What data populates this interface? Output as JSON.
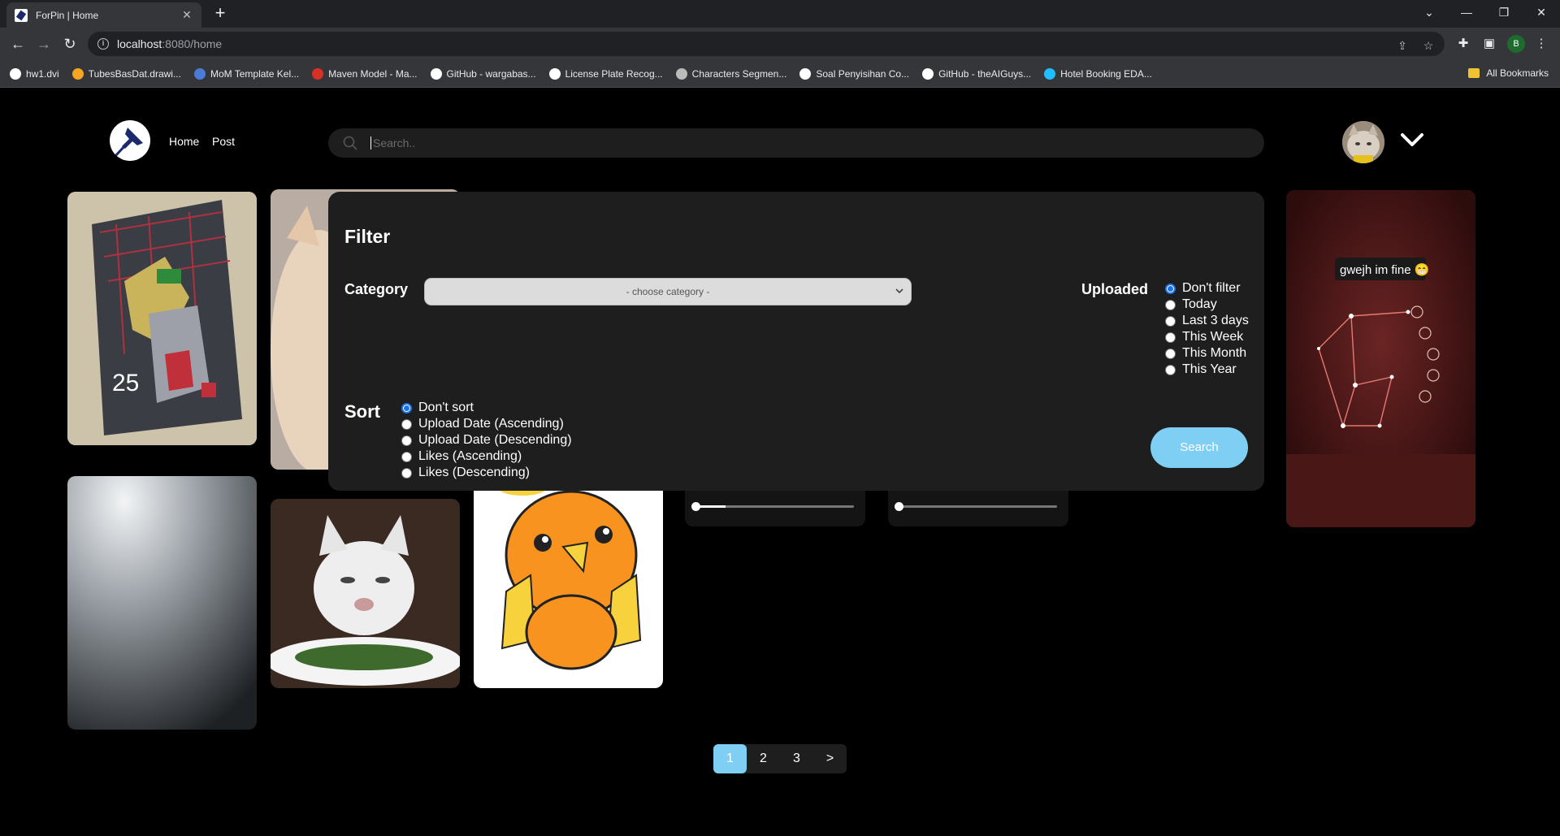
{
  "browser": {
    "tab_title": "ForPin | Home",
    "url_host": "localhost",
    "url_path": ":8080/home",
    "profile_initial": "B",
    "bookmarks": [
      {
        "label": "hw1.dvi",
        "color": "#ffffff"
      },
      {
        "label": "TubesBasDat.drawi...",
        "color": "#f5a623"
      },
      {
        "label": "MoM Template Kel...",
        "color": "#4a7bd8"
      },
      {
        "label": "Maven Model - Ma...",
        "color": "#d93025"
      },
      {
        "label": "GitHub - wargabas...",
        "color": "#ffffff"
      },
      {
        "label": "License Plate Recog...",
        "color": "#ffffff"
      },
      {
        "label": "Characters Segmen...",
        "color": "#bbbbbb"
      },
      {
        "label": "Soal Penyisihan Co...",
        "color": "#ffffff"
      },
      {
        "label": "GitHub - theAIGuys...",
        "color": "#ffffff"
      },
      {
        "label": "Hotel Booking EDA...",
        "color": "#20beff"
      }
    ],
    "all_bookmarks": "All Bookmarks"
  },
  "header": {
    "nav": [
      "Home",
      "Post"
    ],
    "search_placeholder": "Search.."
  },
  "cards": {
    "game_caption": "gwejh im fine 😁"
  },
  "filter": {
    "title": "Filter",
    "category_label": "Category",
    "category_selected": "- choose category -",
    "uploaded_label": "Uploaded",
    "uploaded_options": [
      "Don't filter",
      "Today",
      "Last 3 days",
      "This Week",
      "This Month",
      "This Year"
    ],
    "uploaded_selected": 0,
    "sort_label": "Sort",
    "sort_options": [
      "Don't sort",
      "Upload Date (Ascending)",
      "Upload Date (Descending)",
      "Likes (Ascending)",
      "Likes (Descending)"
    ],
    "sort_selected": 0,
    "search_button": "Search"
  },
  "pagination": {
    "pages": [
      "1",
      "2",
      "3",
      ">"
    ],
    "active": "1"
  },
  "colors": {
    "accent": "#7ecff3",
    "panel": "#1e1e1e",
    "background": "#000000"
  }
}
